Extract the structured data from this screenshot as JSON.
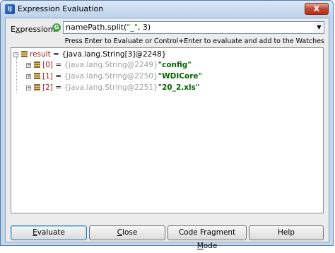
{
  "window": {
    "title": "Expression Evaluation",
    "close_label": "X",
    "app_icon": "IJ"
  },
  "expression": {
    "label_pre": "E",
    "label_ul": "x",
    "label_post": "pression:",
    "scope_icon": "G",
    "value_prefix": "namePath.split(",
    "value_string": "\"_\"",
    "value_suffix": ", 3)"
  },
  "hint": "Press Enter to Evaluate or Control+Enter to evaluate and add to the Watches",
  "tree": {
    "root": {
      "name": "result",
      "eq": " = ",
      "value": "{java.lang.String[3]@2248}"
    },
    "children": [
      {
        "name": "[0]",
        "eq": " = ",
        "type": "{java.lang.String@2249}",
        "value": "\"config\""
      },
      {
        "name": "[1]",
        "eq": " = ",
        "type": "{java.lang.String@2250}",
        "value": "\"WDICore\""
      },
      {
        "name": "[2]",
        "eq": " = ",
        "type": "{java.lang.String@2251}",
        "value": "\"20_2.xls\""
      }
    ]
  },
  "buttons": {
    "evaluate": {
      "pre": "",
      "ul": "E",
      "post": "valuate"
    },
    "close": {
      "pre": "",
      "ul": "C",
      "post": "lose"
    },
    "code_fragment": {
      "pre": "Code Fragment ",
      "ul": "M",
      "post": "ode"
    },
    "help": {
      "pre": "",
      "ul": "",
      "post": "Help"
    }
  }
}
